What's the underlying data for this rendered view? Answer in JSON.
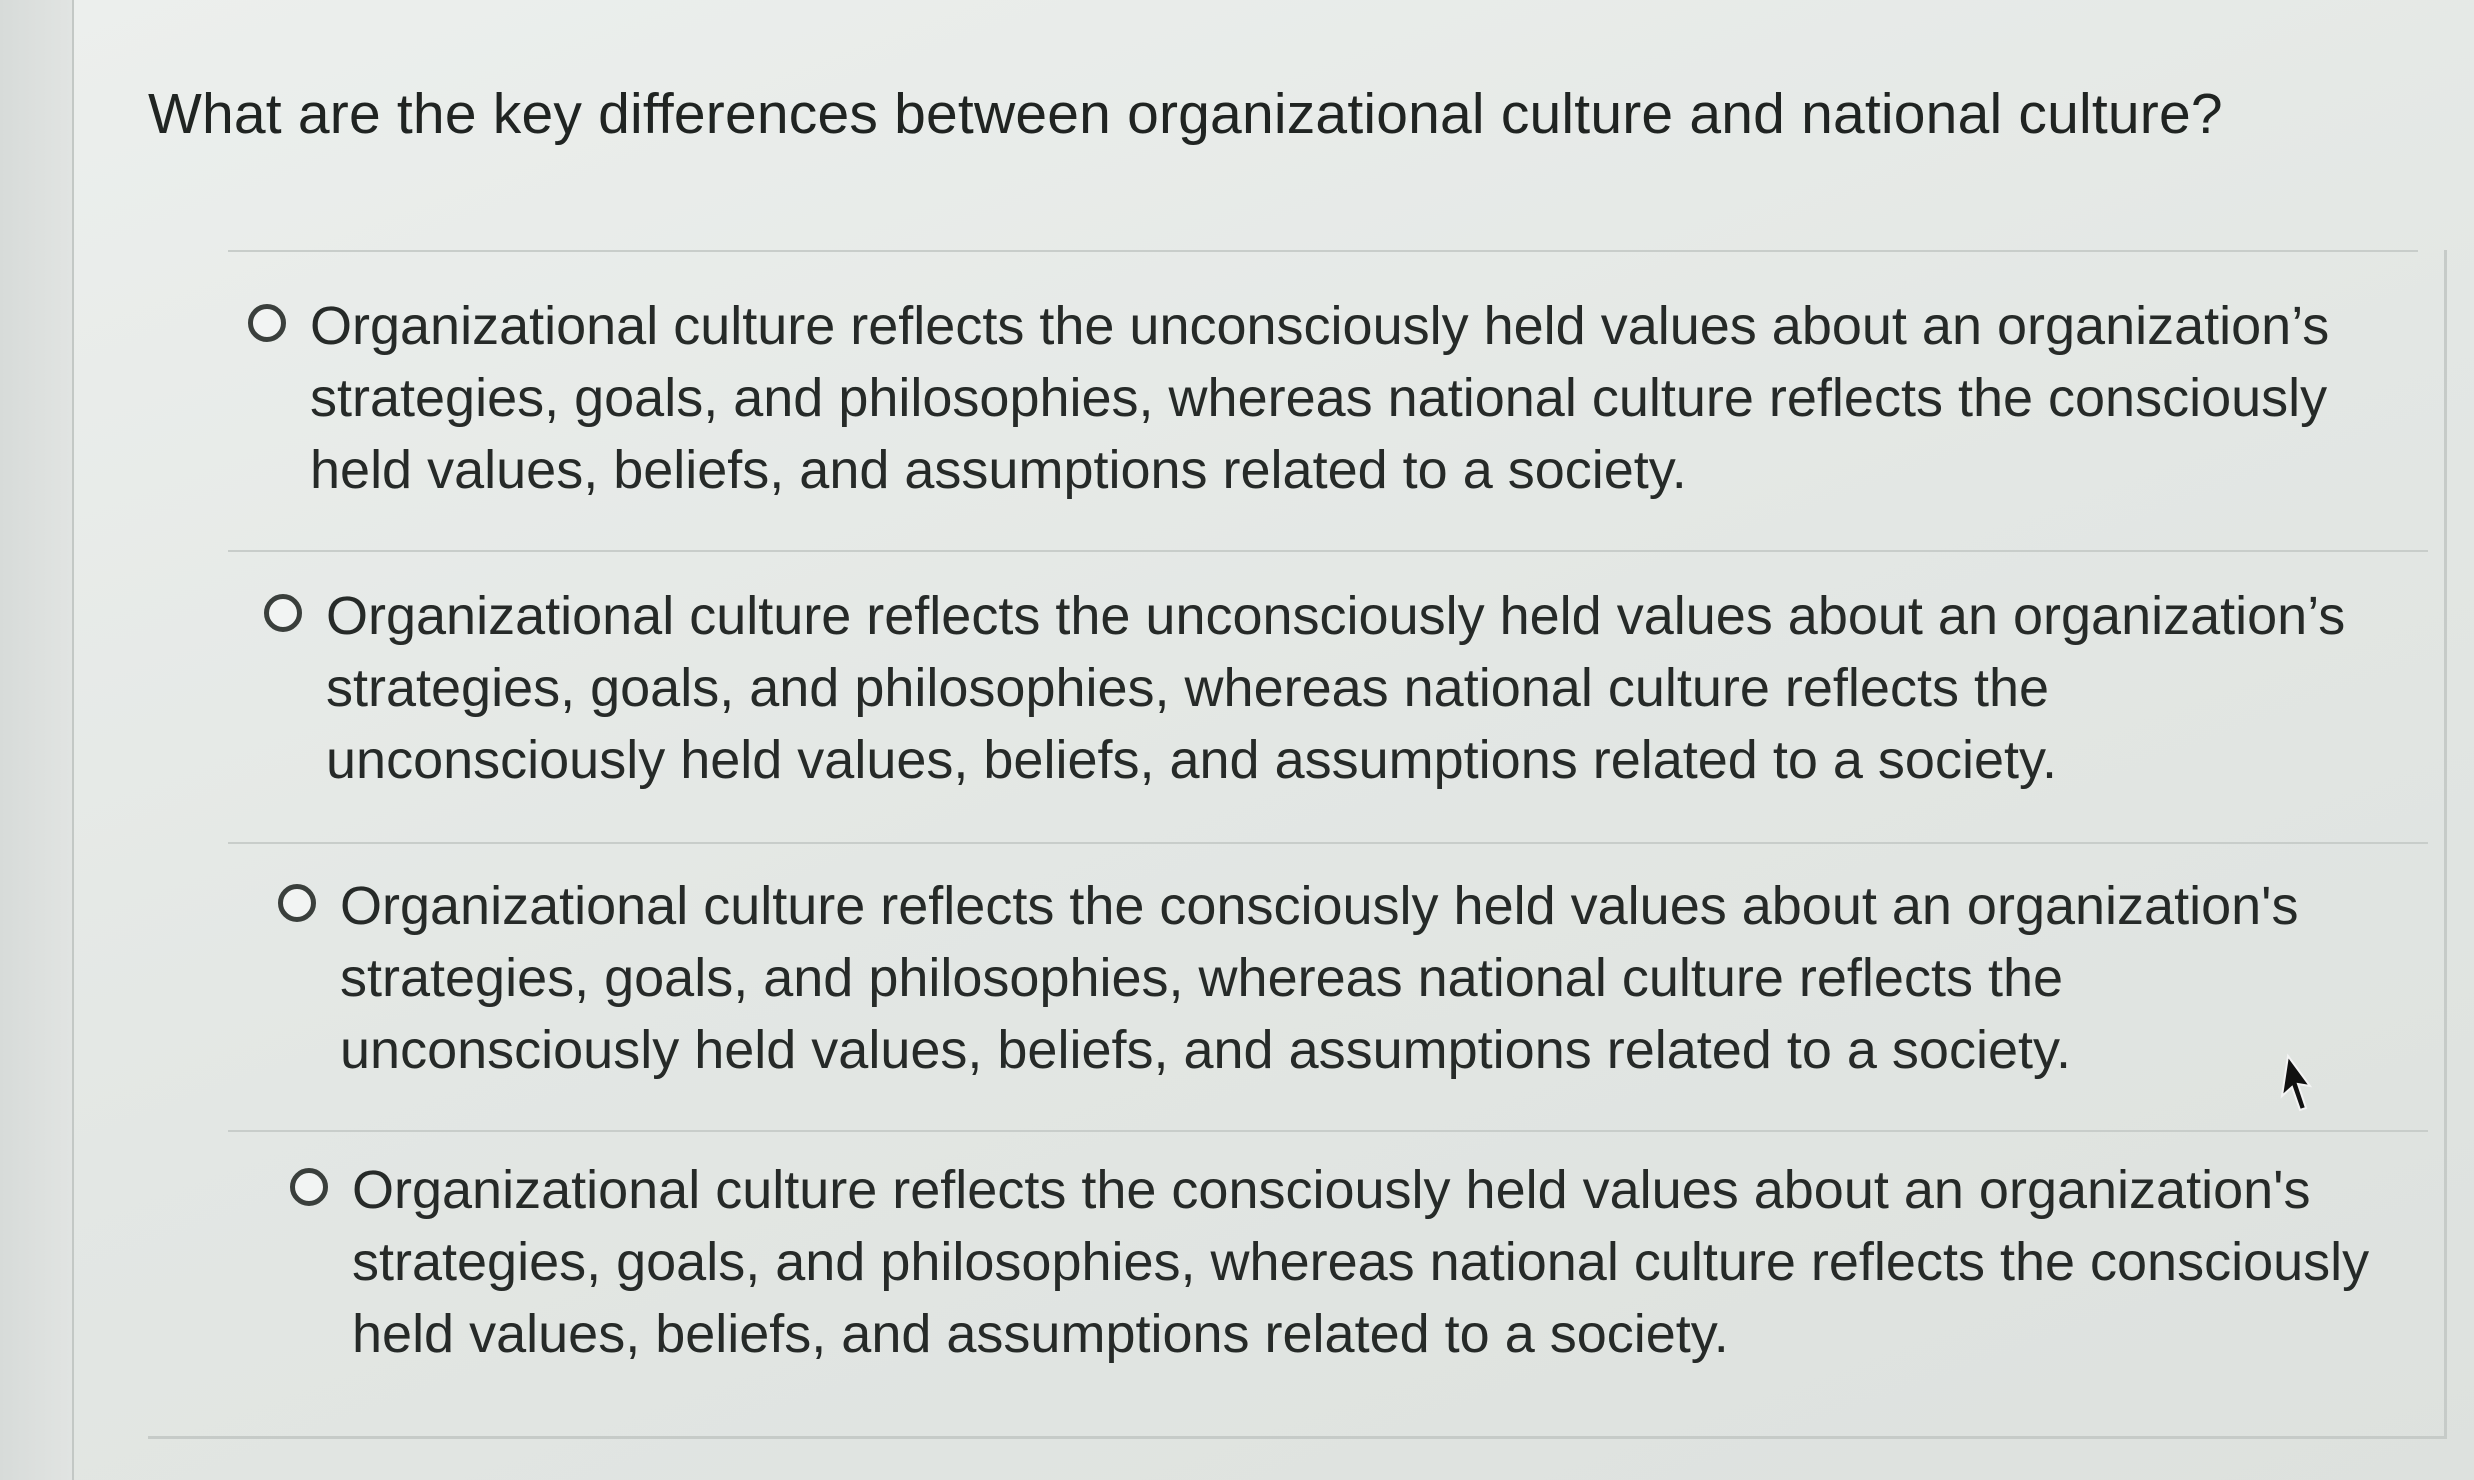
{
  "question": {
    "text": "What are the key differences between organizational culture and national culture?"
  },
  "options": [
    {
      "label": "Organizational culture reflects the unconsciously held values about an organization’s strategies, goals, and philosophies, whereas national culture reflects the consciously held values, beliefs, and assumptions related to a society.",
      "selected": false
    },
    {
      "label": "Organizational culture reflects the unconsciously held values about an organization’s strategies, goals, and philosophies, whereas national culture reflects the unconsciously held values, beliefs, and assumptions related to a society.",
      "selected": false
    },
    {
      "label": "Organizational culture reflects the consciously held values about an organization's strategies, goals, and philosophies, whereas national culture reflects the unconsciously held values, beliefs, and assumptions related to a society.",
      "selected": false
    },
    {
      "label": "Organizational culture reflects the consciously held values about an organization's strategies, goals, and philosophies, whereas national culture reflects the consciously held values, beliefs, and assumptions related to a society.",
      "selected": false
    }
  ],
  "icons": {
    "radio": "radio-button-icon",
    "cursor": "mouse-pointer-icon"
  },
  "colors": {
    "text": "#262a28",
    "background": "#e6e9e7",
    "divider": "#c8cdca"
  }
}
